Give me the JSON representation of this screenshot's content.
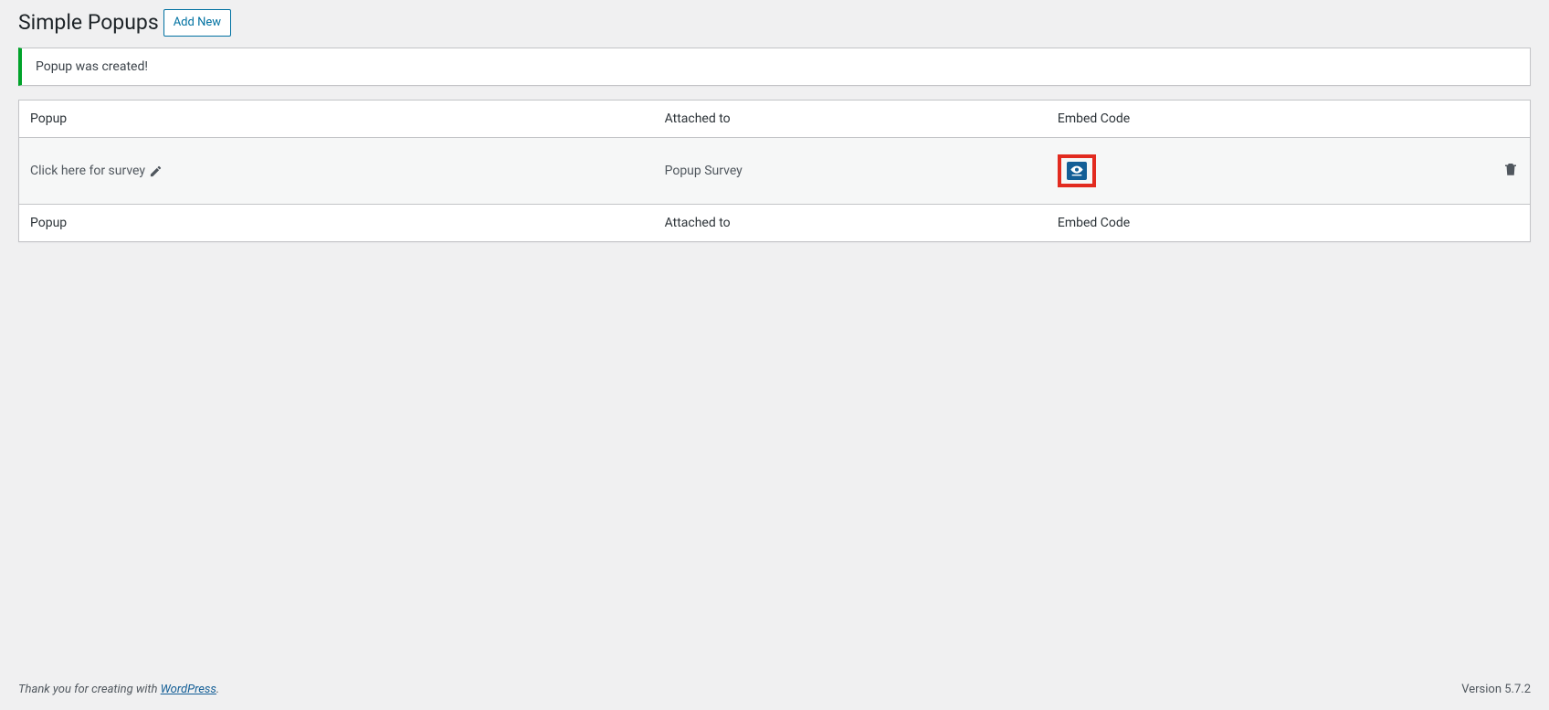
{
  "header": {
    "page_title": "Simple Popups",
    "add_new_label": "Add New"
  },
  "notice": {
    "message": "Popup was created!"
  },
  "table": {
    "columns": {
      "popup": "Popup",
      "attached_to": "Attached to",
      "embed_code": "Embed Code"
    },
    "rows": [
      {
        "name": "Click here for survey",
        "attached_to": "Popup Survey",
        "embed_icon": "preview-icon",
        "action_icon": "trash-icon"
      }
    ]
  },
  "footer": {
    "thank_you_prefix": "Thank you for creating with ",
    "link_text": "WordPress",
    "thank_you_suffix": ".",
    "version_label": "Version 5.7.2"
  }
}
